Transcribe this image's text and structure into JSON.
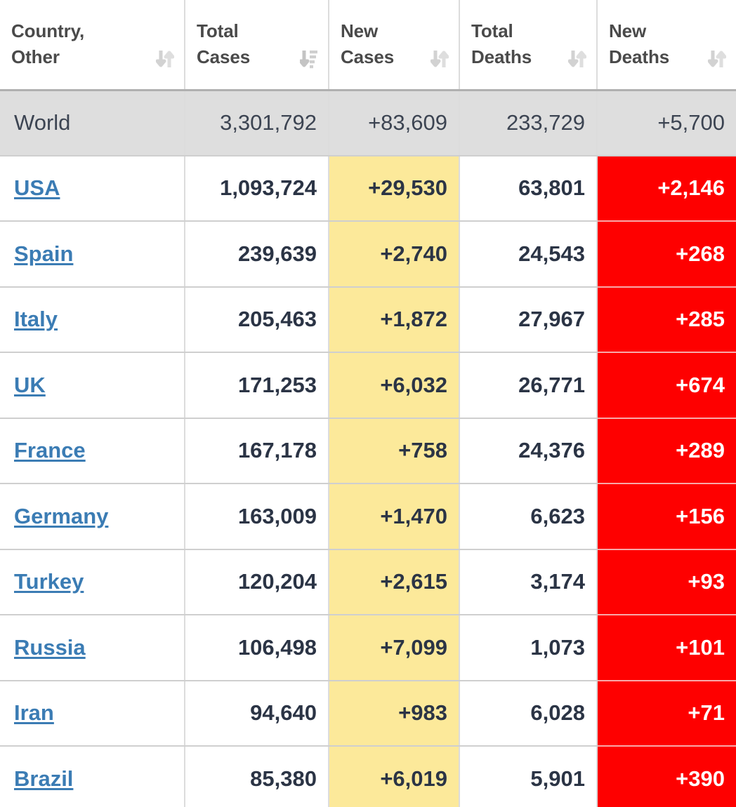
{
  "table": {
    "columns": [
      {
        "key": "country",
        "label": "Country,\nOther",
        "sort_icon": "sort-both-icon",
        "sort_state": "none"
      },
      {
        "key": "total_cases",
        "label": "Total\nCases",
        "sort_icon": "sort-amount-desc-icon",
        "sort_state": "descending"
      },
      {
        "key": "new_cases",
        "label": "New\nCases",
        "sort_icon": "sort-both-icon",
        "sort_state": "none"
      },
      {
        "key": "total_deaths",
        "label": "Total\nDeaths",
        "sort_icon": "sort-both-icon",
        "sort_state": "none"
      },
      {
        "key": "new_deaths",
        "label": "New\nDeaths",
        "sort_icon": "sort-both-icon",
        "sort_state": "none"
      }
    ],
    "rows": [
      {
        "country": "World",
        "is_link": false,
        "total_cases": "3,301,792",
        "new_cases": "+83,609",
        "total_deaths": "233,729",
        "new_deaths": "+5,700"
      },
      {
        "country": "USA",
        "is_link": true,
        "total_cases": "1,093,724",
        "new_cases": "+29,530",
        "total_deaths": "63,801",
        "new_deaths": "+2,146"
      },
      {
        "country": "Spain",
        "is_link": true,
        "total_cases": "239,639",
        "new_cases": "+2,740",
        "total_deaths": "24,543",
        "new_deaths": "+268"
      },
      {
        "country": "Italy",
        "is_link": true,
        "total_cases": "205,463",
        "new_cases": "+1,872",
        "total_deaths": "27,967",
        "new_deaths": "+285"
      },
      {
        "country": "UK",
        "is_link": true,
        "total_cases": "171,253",
        "new_cases": "+6,032",
        "total_deaths": "26,771",
        "new_deaths": "+674"
      },
      {
        "country": "France",
        "is_link": true,
        "total_cases": "167,178",
        "new_cases": "+758",
        "total_deaths": "24,376",
        "new_deaths": "+289"
      },
      {
        "country": "Germany",
        "is_link": true,
        "total_cases": "163,009",
        "new_cases": "+1,470",
        "total_deaths": "6,623",
        "new_deaths": "+156"
      },
      {
        "country": "Turkey",
        "is_link": true,
        "total_cases": "120,204",
        "new_cases": "+2,615",
        "total_deaths": "3,174",
        "new_deaths": "+93"
      },
      {
        "country": "Russia",
        "is_link": true,
        "total_cases": "106,498",
        "new_cases": "+7,099",
        "total_deaths": "1,073",
        "new_deaths": "+101"
      },
      {
        "country": "Iran",
        "is_link": true,
        "total_cases": "94,640",
        "new_cases": "+983",
        "total_deaths": "6,028",
        "new_deaths": "+71"
      },
      {
        "country": "Brazil",
        "is_link": true,
        "total_cases": "85,380",
        "new_cases": "+6,019",
        "total_deaths": "5,901",
        "new_deaths": "+390"
      }
    ]
  },
  "colors": {
    "new_cases_highlight": "#FCE99A",
    "new_deaths_highlight": "#FE0000",
    "world_row_background": "#DEDEDE",
    "link": "#3B7CB4",
    "text": "#2B3445",
    "header_text": "#4A4A4A",
    "grid_line": "#DCDCDC"
  }
}
